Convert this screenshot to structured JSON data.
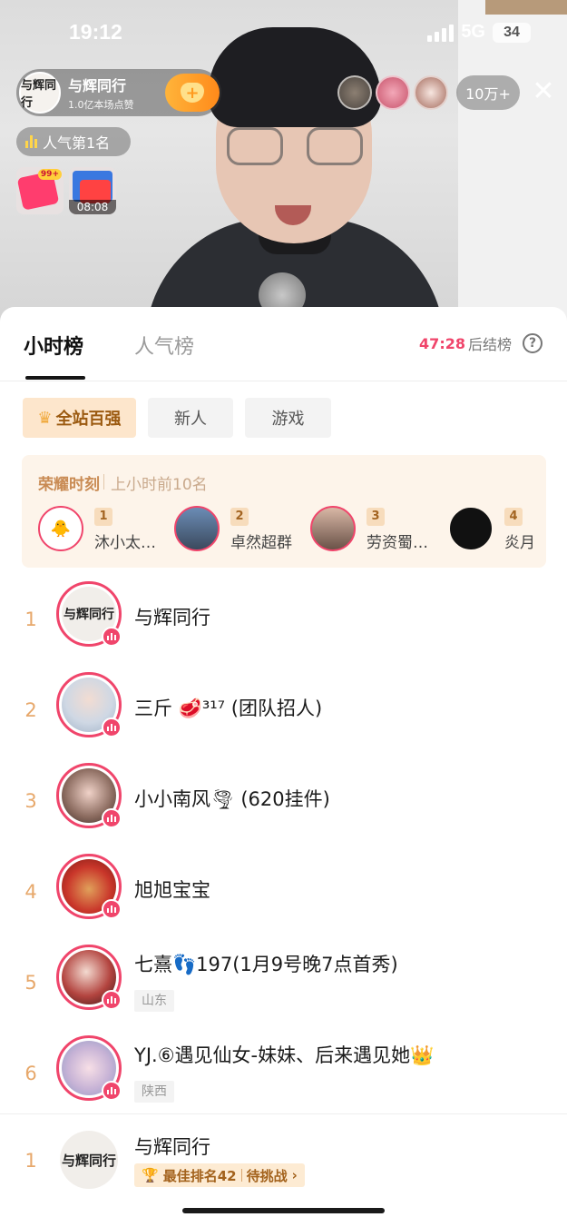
{
  "status_bar": {
    "time": "19:12",
    "network": "5G",
    "battery": "34"
  },
  "live_header": {
    "host_name": "与辉同行",
    "host_likes": "1.0亿本场点赞",
    "host_avatar_text": "与辉同行",
    "follow_icon": "heart-plus-icon",
    "viewer_count": "10万+",
    "popularity_rank": "人气第1名",
    "gift_badge": "99+",
    "gift_timer": "08:08"
  },
  "tabs": [
    {
      "label": "小时榜",
      "active": true
    },
    {
      "label": "人气榜",
      "active": false
    }
  ],
  "countdown": {
    "time": "47:28",
    "suffix": "后结榜",
    "help_icon": "question-circle-icon"
  },
  "categories": [
    {
      "label": "全站百强",
      "active": true,
      "icon": "crown-icon"
    },
    {
      "label": "新人",
      "active": false
    },
    {
      "label": "游戏",
      "active": false
    }
  ],
  "honor": {
    "title": "荣耀时刻",
    "subtitle": "上小时前10名",
    "items": [
      {
        "rank": "1",
        "name": "沐小太…"
      },
      {
        "rank": "2",
        "name": "卓然超群"
      },
      {
        "rank": "3",
        "name": "劳资蜀…"
      },
      {
        "rank": "4",
        "name": "炎月"
      }
    ]
  },
  "ranking": [
    {
      "rank": "1",
      "name": "与辉同行",
      "avatar_text": "与辉同行"
    },
    {
      "rank": "2",
      "name": "三斤 🥩³¹⁷ (团队招人)"
    },
    {
      "rank": "3",
      "name": "小小南风🌪 (620挂件)"
    },
    {
      "rank": "4",
      "name": "旭旭宝宝"
    },
    {
      "rank": "5",
      "name": "七熹👣197(1月9号晚7点首秀)",
      "location": "山东"
    },
    {
      "rank": "6",
      "name": "YJ.⑥遇见仙女-妹妹、后来遇见她👑",
      "location": "陕西"
    }
  ],
  "my_entry": {
    "rank": "1",
    "name": "与辉同行",
    "avatar_text": "与辉同行",
    "best_rank_label": "最佳排名42",
    "challenge_label": "待挑战",
    "trophy_icon": "trophy-icon"
  },
  "colors": {
    "accent": "#f0456b",
    "rank_number": "#e7a86b",
    "chip_active_bg": "#fde6cc"
  }
}
